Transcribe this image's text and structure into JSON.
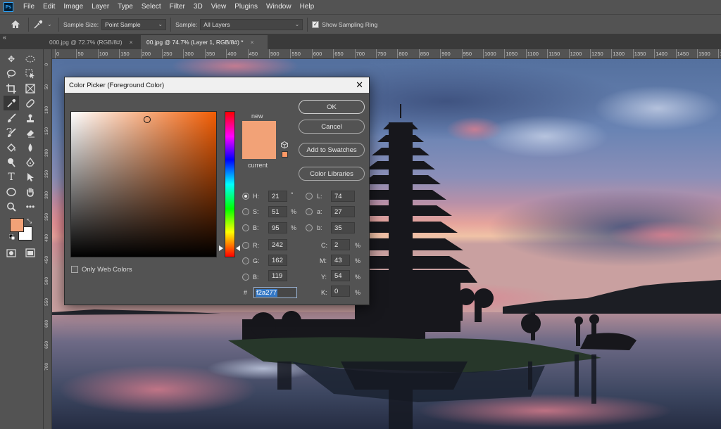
{
  "app": {
    "logo": "Ps"
  },
  "menu": [
    "File",
    "Edit",
    "Image",
    "Layer",
    "Type",
    "Select",
    "Filter",
    "3D",
    "View",
    "Plugins",
    "Window",
    "Help"
  ],
  "options": {
    "sample_size_label": "Sample Size:",
    "sample_size_value": "Point Sample",
    "sample_label": "Sample:",
    "sample_value": "All Layers",
    "show_ring_label": "Show Sampling Ring",
    "show_ring_checked": true
  },
  "tabs": [
    {
      "label": "000.jpg @ 72.7% (RGB/8#)",
      "active": false
    },
    {
      "label": "00.jpg @ 74.7% (Layer 1, RGB/8#) *",
      "active": true
    }
  ],
  "ruler_h": [
    "0",
    "50",
    "100",
    "150",
    "200",
    "250",
    "300",
    "350",
    "400",
    "450",
    "500",
    "550",
    "600",
    "650",
    "700",
    "750",
    "800",
    "850",
    "900",
    "950",
    "1000",
    "1050",
    "1100",
    "1150",
    "1200",
    "1250",
    "1300",
    "1350",
    "1400",
    "1450",
    "1500",
    "155"
  ],
  "ruler_v": [
    "0",
    "50",
    "100",
    "150",
    "200",
    "250",
    "300",
    "350",
    "400",
    "450",
    "500",
    "550",
    "600",
    "650",
    "700"
  ],
  "toolbar": {
    "foreground_color": "#f2a277",
    "background_color": "#ffffff"
  },
  "dialog": {
    "title": "Color Picker (Foreground Color)",
    "new_label": "new",
    "current_label": "current",
    "buttons": {
      "ok": "OK",
      "cancel": "Cancel",
      "add_swatches": "Add to Swatches",
      "color_libraries": "Color Libraries"
    },
    "hsb": {
      "h_label": "H:",
      "h_value": "21",
      "h_unit": "°",
      "s_label": "S:",
      "s_value": "51",
      "s_unit": "%",
      "b_label": "B:",
      "b_value": "95",
      "b_unit": "%"
    },
    "rgb": {
      "r_label": "R:",
      "r_value": "242",
      "g_label": "G:",
      "g_value": "162",
      "b_label": "B:",
      "b_value": "119"
    },
    "lab": {
      "l_label": "L:",
      "l_value": "74",
      "a_label": "a:",
      "a_value": "27",
      "b_label": "b:",
      "b_value": "35"
    },
    "cmyk": {
      "c_label": "C:",
      "c_value": "2",
      "m_label": "M:",
      "m_value": "43",
      "y_label": "Y:",
      "y_value": "54",
      "k_label": "K:",
      "k_value": "0",
      "unit": "%"
    },
    "hex_label": "#",
    "hex_value": "f2a277",
    "only_web_colors": "Only Web Colors",
    "selected_color": "#f2a277",
    "hue_color": "#f25d04"
  }
}
